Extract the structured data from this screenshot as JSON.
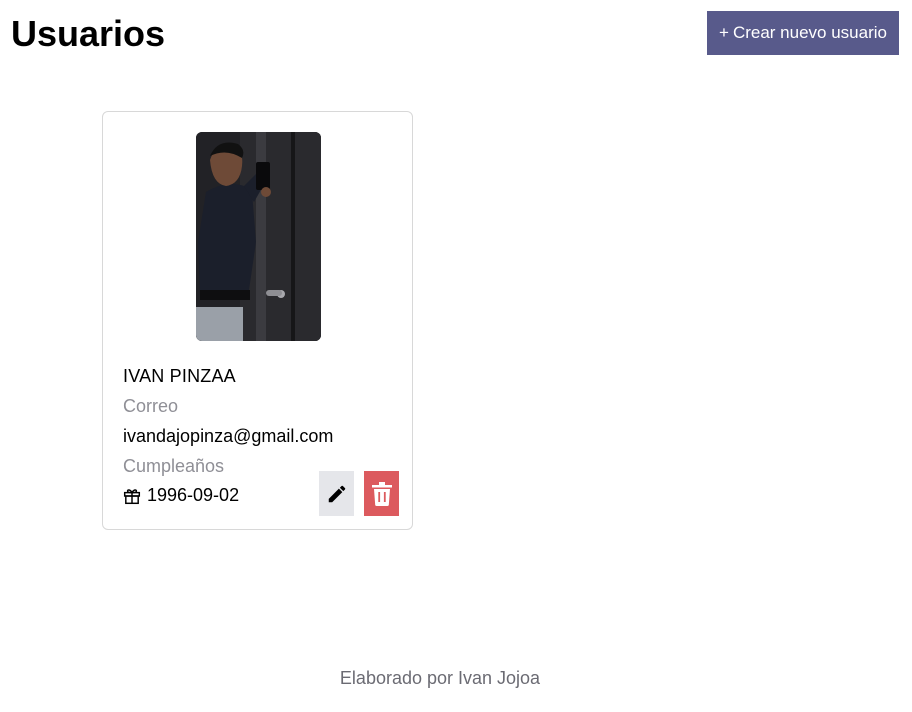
{
  "header": {
    "title": "Usuarios",
    "create_button": {
      "icon_text": "+",
      "label": "Crear nuevo usuario"
    }
  },
  "users": [
    {
      "name": "IVAN PINZAA",
      "email_label": "Correo",
      "email": "ivandajopinza@gmail.com",
      "birthday_label": "Cumpleaños",
      "birthday": "1996-09-02",
      "photo_alt": "user-photo",
      "actions": {
        "edit_icon": "pencil-icon",
        "delete_icon": "trash-icon"
      }
    }
  ],
  "footer": {
    "text": "Elaborado por Ivan Jojoa"
  },
  "colors": {
    "primary_button": "#585a8b",
    "edit_button": "#e5e6ea",
    "delete_button": "#dc5a5e",
    "muted_text": "#8f8f96",
    "footer_text": "#6b6b73"
  }
}
